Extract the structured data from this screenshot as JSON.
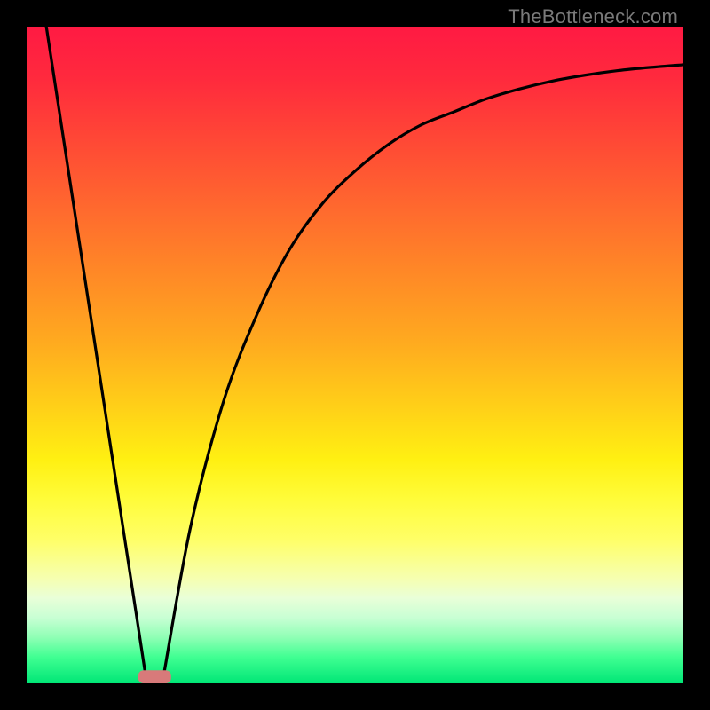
{
  "watermark": "TheBottleneck.com",
  "chart_data": {
    "type": "line",
    "title": "",
    "xlabel": "",
    "ylabel": "",
    "xlim": [
      0,
      100
    ],
    "ylim": [
      0,
      100
    ],
    "grid": false,
    "legend": false,
    "curve_left": {
      "description": "steep descending line from top-left toward valley",
      "points": [
        {
          "x": 3,
          "y": 100
        },
        {
          "x": 18,
          "y": 2
        }
      ]
    },
    "curve_right": {
      "description": "asymptotically rising curve from valley toward upper-right",
      "points": [
        {
          "x": 21,
          "y": 2
        },
        {
          "x": 25,
          "y": 24
        },
        {
          "x": 30,
          "y": 43
        },
        {
          "x": 35,
          "y": 56
        },
        {
          "x": 40,
          "y": 66
        },
        {
          "x": 45,
          "y": 73
        },
        {
          "x": 50,
          "y": 78
        },
        {
          "x": 55,
          "y": 82
        },
        {
          "x": 60,
          "y": 85
        },
        {
          "x": 65,
          "y": 87
        },
        {
          "x": 70,
          "y": 89
        },
        {
          "x": 75,
          "y": 90.5
        },
        {
          "x": 80,
          "y": 91.7
        },
        {
          "x": 85,
          "y": 92.6
        },
        {
          "x": 90,
          "y": 93.3
        },
        {
          "x": 95,
          "y": 93.8
        },
        {
          "x": 100,
          "y": 94.2
        }
      ]
    },
    "marker": {
      "description": "pink rounded-rect marker at valley bottom on green band",
      "x_center": 19.5,
      "y": 1,
      "width": 5,
      "height": 2
    }
  }
}
